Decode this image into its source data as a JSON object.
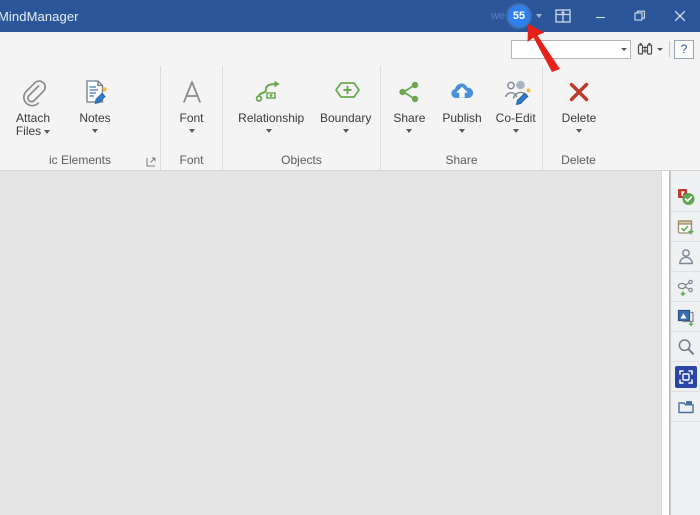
{
  "window": {
    "title": "MindManager",
    "faint_label": "we",
    "badge_count": "55",
    "minimize_label": "Minimize",
    "restore_label": "Restore",
    "close_label": "Close",
    "ribbon_display_label": "Ribbon Display Options",
    "titlebar_color": "#2b579a",
    "badge_color": "#2f7ff0"
  },
  "search": {
    "value": "",
    "placeholder": "",
    "find_label": "Find",
    "help_label": "?"
  },
  "ribbon": {
    "groups": [
      {
        "name": "ic Elements",
        "has_launcher": true,
        "items": [
          {
            "label": "Attach Files",
            "icon": "paperclip-icon",
            "dropdown": "inline"
          },
          {
            "label": "Notes",
            "icon": "notes-icon",
            "dropdown": "below"
          }
        ]
      },
      {
        "name": "Font",
        "has_launcher": false,
        "items": [
          {
            "label": "Font",
            "icon": "font-a-icon",
            "dropdown": "below"
          }
        ]
      },
      {
        "name": "Objects",
        "has_launcher": false,
        "items": [
          {
            "label": "Relationship",
            "icon": "relationship-icon",
            "dropdown": "below"
          },
          {
            "label": "Boundary",
            "icon": "boundary-icon",
            "dropdown": "below"
          }
        ]
      },
      {
        "name": "Share",
        "has_launcher": false,
        "items": [
          {
            "label": "Share",
            "icon": "share-nodes-icon",
            "dropdown": "below"
          },
          {
            "label": "Publish",
            "icon": "cloud-upload-icon",
            "dropdown": "below"
          },
          {
            "label": "Co-Edit",
            "icon": "co-edit-icon",
            "dropdown": "below"
          }
        ]
      },
      {
        "name": "Delete",
        "has_launcher": false,
        "items": [
          {
            "label": "Delete",
            "icon": "red-x-icon",
            "dropdown": "below"
          }
        ]
      }
    ]
  },
  "task_pane": {
    "items": [
      {
        "name": "markers-icon",
        "label": "Markers",
        "active": false
      },
      {
        "name": "task-info-icon",
        "label": "Task Info",
        "active": false
      },
      {
        "name": "person-icon",
        "label": "Resources",
        "active": false
      },
      {
        "name": "topic-branch-icon",
        "label": "Topic Elements",
        "active": false
      },
      {
        "name": "image-icon",
        "label": "Images",
        "active": false
      },
      {
        "name": "search-icon",
        "label": "Search",
        "active": false
      },
      {
        "name": "focus-brackets-icon",
        "label": "Focus",
        "active": true
      },
      {
        "name": "library-folder-icon",
        "label": "Library",
        "active": false
      }
    ]
  },
  "canvas": {
    "background_color": "#e4e4e4"
  }
}
